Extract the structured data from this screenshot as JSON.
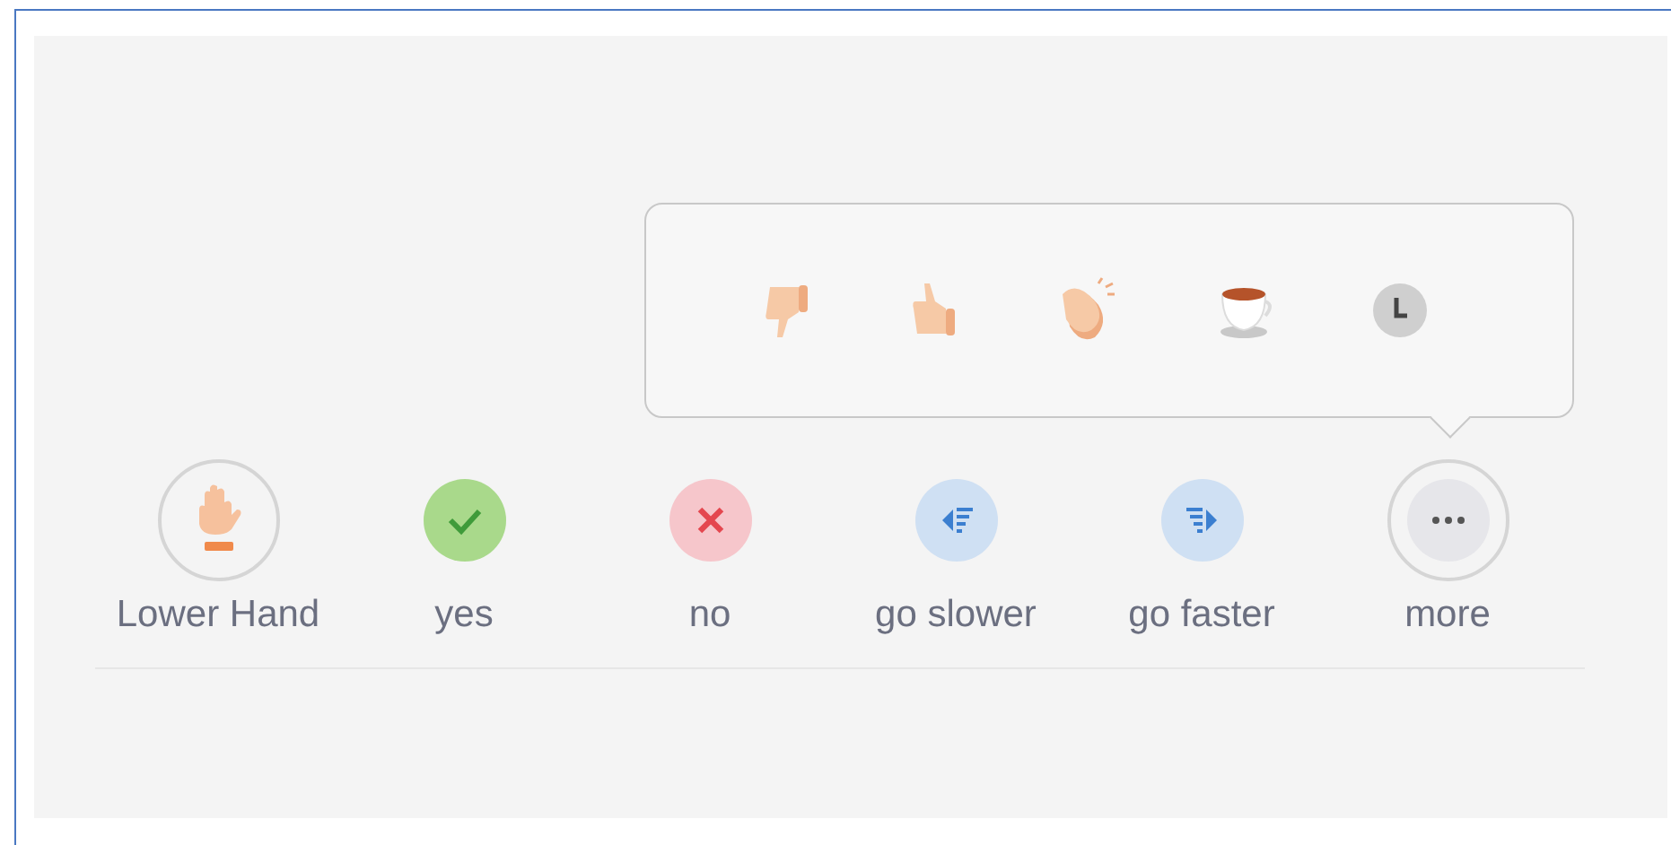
{
  "popup": {
    "reactions": [
      {
        "kind": "thumbs-down"
      },
      {
        "kind": "thumbs-up"
      },
      {
        "kind": "clap"
      },
      {
        "kind": "coffee"
      },
      {
        "kind": "clock"
      }
    ]
  },
  "actions": [
    {
      "kind": "hand",
      "label": "Lower Hand",
      "selected": true
    },
    {
      "kind": "yes",
      "label": "yes",
      "selected": false
    },
    {
      "kind": "no",
      "label": "no",
      "selected": false
    },
    {
      "kind": "slower",
      "label": "go slower",
      "selected": false
    },
    {
      "kind": "faster",
      "label": "go faster",
      "selected": false
    },
    {
      "kind": "more",
      "label": "more",
      "selected": true
    }
  ]
}
